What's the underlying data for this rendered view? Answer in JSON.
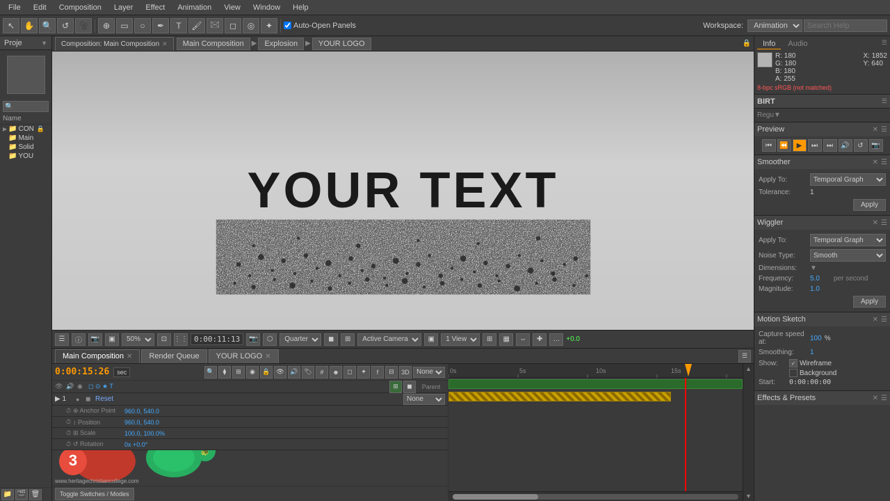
{
  "menu": {
    "items": [
      "File",
      "Edit",
      "Composition",
      "Layer",
      "Effect",
      "Animation",
      "View",
      "Window",
      "Help"
    ]
  },
  "toolbar": {
    "auto_open": "Auto-Open Panels",
    "workspace_label": "Workspace:",
    "workspace_value": "Animation",
    "search_placeholder": "Search Help"
  },
  "project": {
    "panel_label": "Proje",
    "search_placeholder": "🔍",
    "name_header": "Name",
    "items": [
      {
        "label": "CON",
        "type": "folder",
        "expanded": true
      },
      {
        "label": "Main",
        "type": "folder",
        "indent": 1
      },
      {
        "label": "Solid",
        "type": "folder",
        "indent": 1
      },
      {
        "label": "YOU",
        "type": "folder",
        "indent": 1
      }
    ]
  },
  "comp_viewer": {
    "tab_label": "Composition: Main Composition",
    "breadcrumbs": [
      "Main Composition",
      "Explosion",
      "YOUR LOGO"
    ],
    "canvas_text": "YOUR TEXT",
    "time_display": "0:00:11:13",
    "quality": "Quarter",
    "view_mode": "Active Camera",
    "view_layout": "1 View",
    "zoom": "50%",
    "plus_val": "+0.0"
  },
  "timeline": {
    "tabs": [
      {
        "label": "Main Composition",
        "active": true
      },
      {
        "label": "Render Queue"
      },
      {
        "label": "YOUR LOGO"
      }
    ],
    "time_display": "0:00:15:26",
    "time_unit": "sec",
    "parent_label": "Parent",
    "parent_value": "None",
    "layer_name": "Reset",
    "anchor_val": "960.0, 540.0",
    "position_val": "960.0, 540.0",
    "scale_val": "100.0, 100.0%",
    "rotation_val": "0x +0.0°",
    "toggle_switches": "Toggle Switches / Modes",
    "time_markers": [
      "",
      "0s",
      "5s",
      "10s",
      "15s"
    ]
  },
  "right_panel": {
    "info_tab": "Info",
    "audio_tab": "Audio",
    "color_r": "R: 180",
    "color_g": "G: 180",
    "color_b": "B: 180",
    "color_a": "A: 255",
    "coord_x": "X: 1852",
    "coord_y": "Y: 640",
    "error_text": "8-bpc sRGB (not matched)",
    "preview_title": "Preview",
    "smoother_title": "Smoother",
    "smoother_apply_to_label": "Apply To:",
    "smoother_apply_to_val": "Temporal Graph",
    "smoother_tolerance_label": "Tolerance:",
    "smoother_tolerance_val": "1",
    "smoother_apply_btn": "Apply",
    "wiggler_title": "Wiggler",
    "wiggler_apply_to_label": "Apply To:",
    "wiggler_apply_to_val": "Temporal Graph",
    "wiggler_noise_label": "Noise Type:",
    "wiggler_noise_val": "Smooth",
    "wiggler_dim_label": "Dimensions:",
    "wiggler_freq_label": "Frequency:",
    "wiggler_freq_val": "5.0",
    "wiggler_freq_unit": "per second",
    "wiggler_mag_label": "Magnitude:",
    "wiggler_mag_val": "1.0",
    "wiggler_apply_btn": "Apply",
    "motion_title": "Motion Sketch",
    "motion_capture_label": "Capture speed at:",
    "motion_capture_val": "100",
    "motion_capture_pct": "%",
    "motion_smooth_label": "Smoothing:",
    "motion_smooth_val": "1",
    "motion_show_label": "Show:",
    "motion_wireframe": "Wireframe",
    "motion_background": "Background",
    "motion_start_label": "Start:",
    "motion_start_val": "0:00:00:00",
    "effects_title": "Effects & Presets",
    "bday_label": "BIRT"
  }
}
